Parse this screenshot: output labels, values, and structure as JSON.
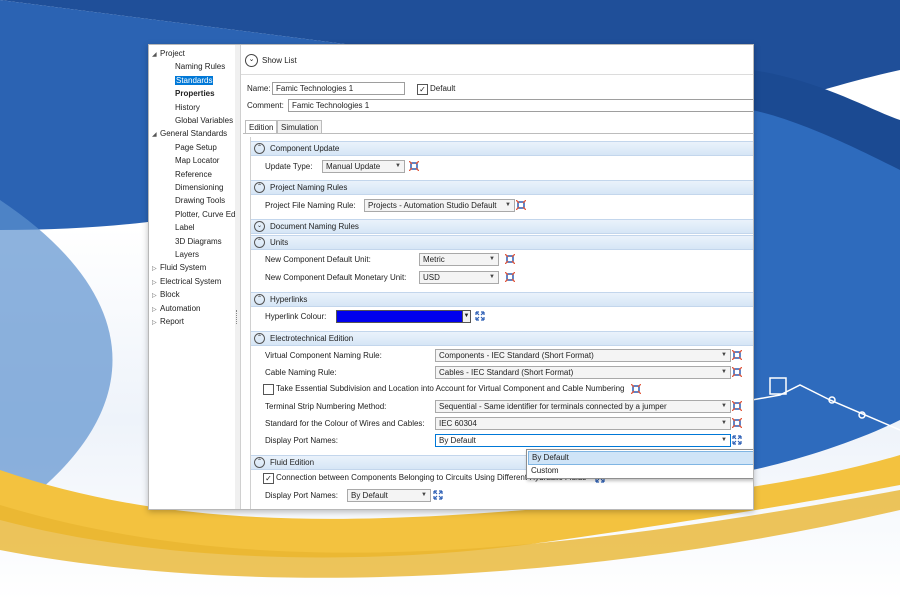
{
  "colors": {
    "accent": "#0078d7",
    "hyperlink_colour": "#0000ee",
    "section_bg": "#dae8f6"
  },
  "tree": [
    {
      "label": "Project",
      "level": 0,
      "expander": "expanded"
    },
    {
      "label": "Naming Rules",
      "level": 2
    },
    {
      "label": "Standards",
      "level": 2,
      "selected": true
    },
    {
      "label": "Properties",
      "level": 2,
      "bold": true
    },
    {
      "label": "History",
      "level": 2
    },
    {
      "label": "Global Variables",
      "level": 2
    },
    {
      "label": "General Standards",
      "level": 0,
      "expander": "expanded"
    },
    {
      "label": "Page Setup",
      "level": 2
    },
    {
      "label": "Map Locator",
      "level": 2
    },
    {
      "label": "Reference",
      "level": 2
    },
    {
      "label": "Dimensioning",
      "level": 2
    },
    {
      "label": "Drawing Tools",
      "level": 2
    },
    {
      "label": "Plotter, Curve Ed",
      "level": 2
    },
    {
      "label": "Label",
      "level": 2
    },
    {
      "label": "3D Diagrams",
      "level": 2
    },
    {
      "label": "Layers",
      "level": 2
    },
    {
      "label": "Fluid System",
      "level": 0,
      "expander": "collapsed"
    },
    {
      "label": "Electrical System",
      "level": 0,
      "expander": "collapsed"
    },
    {
      "label": "Block",
      "level": 0,
      "expander": "collapsed"
    },
    {
      "label": "Automation",
      "level": 0,
      "expander": "collapsed"
    },
    {
      "label": "Report",
      "level": 0,
      "expander": "collapsed"
    }
  ],
  "header": {
    "show_list": "Show List",
    "name_label": "Name:",
    "name_value": "Famic Technologies 1",
    "default_label": "Default",
    "default_checked": true,
    "comment_label": "Comment:",
    "comment_value": "Famic Technologies 1"
  },
  "tabs": [
    {
      "label": "Edition",
      "active": true
    },
    {
      "label": "Simulation",
      "active": false
    }
  ],
  "sections": {
    "component_update": {
      "title": "Component Update",
      "update_type_label": "Update Type:",
      "update_type_value": "Manual Update"
    },
    "project_naming": {
      "title": "Project Naming Rules",
      "file_rule_label": "Project File Naming Rule:",
      "file_rule_value": "Projects - Automation Studio Default"
    },
    "document_naming": {
      "title": "Document Naming Rules"
    },
    "units": {
      "title": "Units",
      "unit_label": "New Component Default Unit:",
      "unit_value": "Metric",
      "monetary_label": "New Component Default Monetary Unit:",
      "monetary_value": "USD"
    },
    "hyperlinks": {
      "title": "Hyperlinks",
      "colour_label": "Hyperlink Colour:"
    },
    "electro": {
      "title": "Electrotechnical Edition",
      "virtual_label": "Virtual Component Naming Rule:",
      "virtual_value": "Components - IEC Standard (Short Format)",
      "cable_label": "Cable Naming Rule:",
      "cable_value": "Cables - IEC Standard (Short Format)",
      "subdivision_label": "Take Essential Subdivision and Location into Account for Virtual Component and Cable Numbering",
      "subdivision_checked": false,
      "terminal_label": "Terminal Strip Numbering Method:",
      "terminal_value": "Sequential - Same identifier for terminals connected by a jumper",
      "wire_label": "Standard for the Colour of Wires and Cables:",
      "wire_value": "IEC 60304",
      "port_label": "Display Port Names:",
      "port_value": "By Default"
    },
    "fluid": {
      "title": "Fluid Edition",
      "connection_label": "Connection between Components Belonging to Circuits Using Different Hydraulic Fluids",
      "connection_checked": true,
      "port_label": "Display Port Names:",
      "port_value": "By Default"
    }
  },
  "dropdown_options": [
    "By Default",
    "Custom"
  ],
  "icons": {
    "expand": "chevron-down-icon",
    "collapse": "chevron-up-icon",
    "reset": "reset-icon",
    "expand_arrows": "expand-arrows-icon"
  }
}
